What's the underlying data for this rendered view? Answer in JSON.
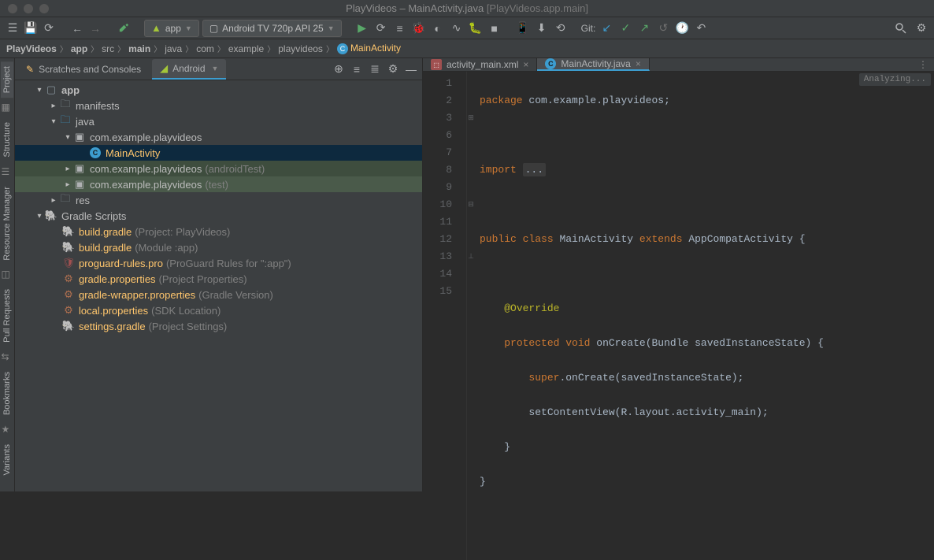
{
  "titlebar": {
    "project": "PlayVideos",
    "file": "MainActivity.java",
    "context": "[PlayVideos.app.main]"
  },
  "toolbar": {
    "runconfig": "app",
    "device": "Android TV 720p API 25",
    "git_label": "Git:"
  },
  "breadcrumb": {
    "items": [
      "PlayVideos",
      "app",
      "src",
      "main",
      "java",
      "com",
      "example",
      "playvideos"
    ],
    "class": "MainActivity"
  },
  "panel": {
    "tab_scratches": "Scratches and Consoles",
    "tab_android": "Android"
  },
  "tree": {
    "app": "app",
    "manifests": "manifests",
    "java": "java",
    "pkg1": "com.example.playvideos",
    "mainactivity": "MainActivity",
    "pkg2": "com.example.playvideos",
    "pkg2_hint": "(androidTest)",
    "pkg3": "com.example.playvideos",
    "pkg3_hint": "(test)",
    "res": "res",
    "gradle_scripts": "Gradle Scripts",
    "bg1": "build.gradle",
    "bg1_hint": "(Project: PlayVideos)",
    "bg2": "build.gradle",
    "bg2_hint": "(Module :app)",
    "pro": "proguard-rules.pro",
    "pro_hint": "(ProGuard Rules for \":app\")",
    "gp": "gradle.properties",
    "gp_hint": "(Project Properties)",
    "gwp": "gradle-wrapper.properties",
    "gwp_hint": "(Gradle Version)",
    "lp": "local.properties",
    "lp_hint": "(SDK Location)",
    "sg": "settings.gradle",
    "sg_hint": "(Project Settings)"
  },
  "editor_tabs": {
    "tab1": "activity_main.xml",
    "tab2": "MainActivity.java"
  },
  "analyzing": "Analyzing...",
  "leftbar": {
    "project": "Project",
    "structure": "Structure",
    "resmgr": "Resource Manager",
    "pullreq": "Pull Requests",
    "bookmarks": "Bookmarks",
    "variants": "Variants"
  },
  "code": {
    "l1_kw": "package",
    "l1_pkg": "com.example.playvideos",
    "l3_kw": "import",
    "l3_dots": "...",
    "l7_public": "public",
    "l7_class": "class",
    "l7_name": "MainActivity",
    "l7_extends": "extends",
    "l7_super": "AppCompatActivity",
    "l9_ann": "@Override",
    "l10_protected": "protected",
    "l10_void": "void",
    "l10_sig": "onCreate(Bundle savedInstanceState) {",
    "l11_super": "super",
    "l11_rest": ".onCreate(savedInstanceState);",
    "l12": "setContentView(R.layout.activity_main);",
    "l13": "}",
    "l14": "}"
  },
  "line_numbers": [
    "1",
    "2",
    "3",
    "6",
    "7",
    "8",
    "9",
    "10",
    "11",
    "12",
    "13",
    "14",
    "15"
  ]
}
